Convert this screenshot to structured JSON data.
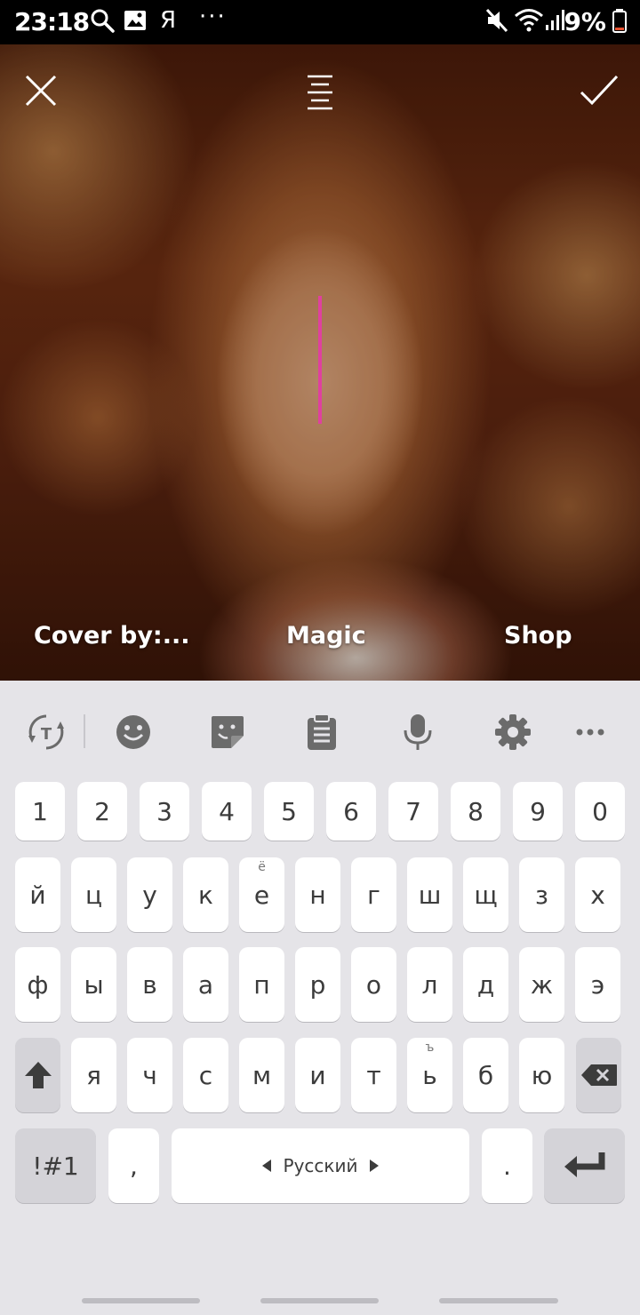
{
  "status": {
    "time": "23:18",
    "letter": "Я",
    "dots": "···",
    "battery": "9%"
  },
  "editor": {
    "captions": [
      "Cover by:...",
      "Magic",
      "Shop"
    ]
  },
  "keyboard": {
    "numbers": [
      "1",
      "2",
      "3",
      "4",
      "5",
      "6",
      "7",
      "8",
      "9",
      "0"
    ],
    "row1": [
      "й",
      "ц",
      "у",
      "к",
      "е",
      "н",
      "г",
      "ш",
      "щ",
      "з",
      "х"
    ],
    "row1_sub": {
      "е": "ё"
    },
    "row2": [
      "ф",
      "ы",
      "в",
      "а",
      "п",
      "р",
      "о",
      "л",
      "д",
      "ж",
      "э"
    ],
    "row3": [
      "я",
      "ч",
      "с",
      "м",
      "и",
      "т",
      "ь",
      "б",
      "ю"
    ],
    "row3_sub": {
      "ь": "ъ"
    },
    "symbols_label": "!#1",
    "comma": ",",
    "space_label": "Русский",
    "period": "."
  },
  "colors": {
    "cursor": "#e0409f",
    "keyboard_bg": "#e5e4e8"
  }
}
